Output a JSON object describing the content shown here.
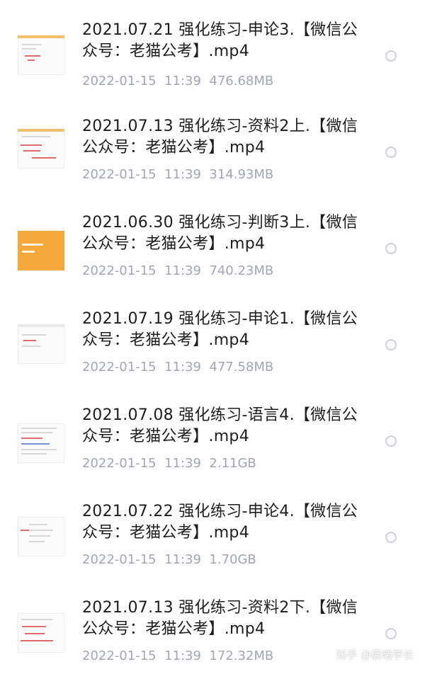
{
  "files": [
    {
      "title": "2021.07.21 强化练习-申论3.【微信公众号：老猫公考】.mp4",
      "date": "2022-01-15",
      "time": "11:39",
      "size": "476.68MB",
      "thumb": "notes-red"
    },
    {
      "title": "2021.07.13 强化练习-资料2上.【微信公众号：老猫公考】.mp4",
      "date": "2022-01-15",
      "time": "11:39",
      "size": "314.93MB",
      "thumb": "notes-sketch"
    },
    {
      "title": "2021.06.30 强化练习-判断3上.【微信公众号：老猫公考】.mp4",
      "date": "2022-01-15",
      "time": "11:39",
      "size": "740.23MB",
      "thumb": "orange-slide"
    },
    {
      "title": "2021.07.19 强化练习-申论1.【微信公众号：老猫公考】.mp4",
      "date": "2022-01-15",
      "time": "11:39",
      "size": "477.58MB",
      "thumb": "notes-light"
    },
    {
      "title": "2021.07.08 强化练习-语言4.【微信公众号：老猫公考】.mp4",
      "date": "2022-01-15",
      "time": "11:39",
      "size": "2.11GB",
      "thumb": "text-slide"
    },
    {
      "title": "2021.07.22 强化练习-申论4.【微信公众号：老猫公考】.mp4",
      "date": "2022-01-15",
      "time": "11:39",
      "size": "1.70GB",
      "thumb": "mindmap"
    },
    {
      "title": "2021.07.13 强化练习-资料2下.【微信公众号：老猫公考】.mp4",
      "date": "2022-01-15",
      "time": "11:39",
      "size": "172.32MB",
      "thumb": "notes-red"
    }
  ],
  "watermark": "知乎 @晨曦学长"
}
